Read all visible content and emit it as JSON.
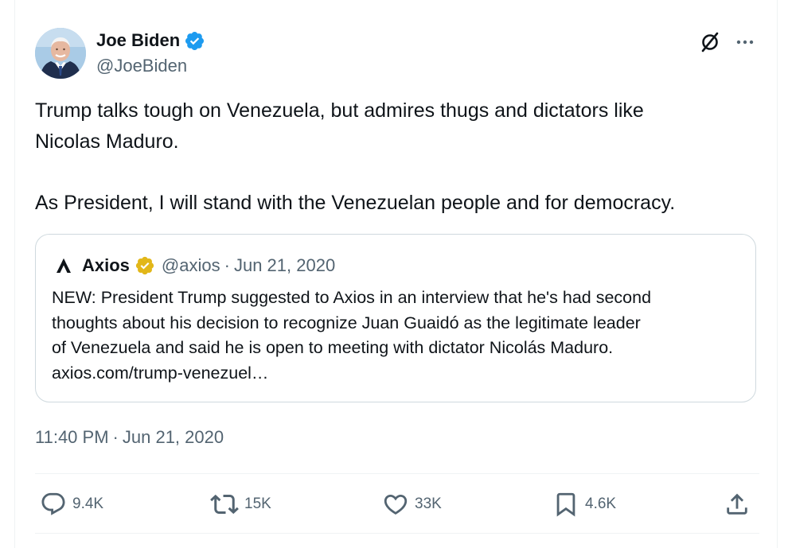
{
  "colors": {
    "accent": "#1d9bf0",
    "text": "#0f1419",
    "muted": "#536471",
    "border": "#cfd9de",
    "gold": "#e2b719"
  },
  "author": {
    "display_name": "Joe Biden",
    "handle": "@JoeBiden",
    "avatar_icon": "avatar-photo",
    "verified_icon": "blue-verified-badge-icon"
  },
  "header_icons": {
    "grok": "grok-icon",
    "more": "more-icon"
  },
  "tweet": {
    "text": "Trump talks tough on Venezuela, but admires thugs and dictators like\nNicolas Maduro.\n\nAs President, I will stand with the Venezuelan people and for democracy."
  },
  "quote": {
    "logo_icon": "axios-logo-icon",
    "name": "Axios",
    "verified_icon": "gold-verified-badge-icon",
    "handle": "@axios",
    "separator": "·",
    "date": "Jun 21, 2020",
    "lines": [
      "NEW: President Trump suggested to Axios in an interview that he's had second",
      "thoughts about his decision to recognize Juan Guaidó as the legitimate leader",
      "of Venezuela and said he is open to meeting with dictator Nicolás Maduro.",
      "axios.com/trump-venezuel…"
    ]
  },
  "timestamp": {
    "time": "11:40 PM",
    "separator": "·",
    "date": "Jun 21, 2020"
  },
  "actions": {
    "reply": {
      "icon": "reply-icon",
      "count": "9.4K"
    },
    "retweet": {
      "icon": "retweet-icon",
      "count": "15K"
    },
    "like": {
      "icon": "like-icon",
      "count": "33K"
    },
    "bookmark": {
      "icon": "bookmark-icon",
      "count": "4.6K"
    },
    "share": {
      "icon": "share-icon"
    }
  }
}
